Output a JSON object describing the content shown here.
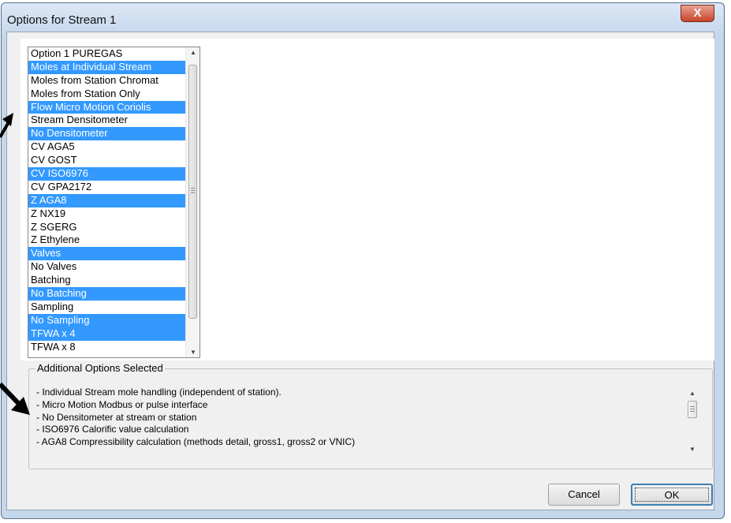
{
  "window": {
    "title": "Options for Stream 1"
  },
  "options_list": {
    "items": [
      {
        "label": "Option 1 PUREGAS",
        "selected": false
      },
      {
        "label": "Moles at Individual Stream",
        "selected": true
      },
      {
        "label": "Moles from Station Chromat",
        "selected": false
      },
      {
        "label": "Moles from Station Only",
        "selected": false
      },
      {
        "label": "Flow Micro Motion Coriolis",
        "selected": true
      },
      {
        "label": "Stream Densitometer",
        "selected": false
      },
      {
        "label": "No Densitometer",
        "selected": true
      },
      {
        "label": "CV AGA5",
        "selected": false
      },
      {
        "label": "CV GOST",
        "selected": false
      },
      {
        "label": "CV ISO6976",
        "selected": true
      },
      {
        "label": "CV GPA2172",
        "selected": false
      },
      {
        "label": "Z AGA8",
        "selected": true
      },
      {
        "label": "Z NX19",
        "selected": false
      },
      {
        "label": "Z SGERG",
        "selected": false
      },
      {
        "label": "Z Ethylene",
        "selected": false
      },
      {
        "label": "Valves",
        "selected": true
      },
      {
        "label": "No Valves",
        "selected": false
      },
      {
        "label": "Batching",
        "selected": false
      },
      {
        "label": "No Batching",
        "selected": true
      },
      {
        "label": "Sampling",
        "selected": false
      },
      {
        "label": "No Sampling",
        "selected": true
      },
      {
        "label": "TFWA x 4",
        "selected": true
      },
      {
        "label": "TFWA x 8",
        "selected": false
      }
    ]
  },
  "additional": {
    "label": "Additional Options Selected",
    "lines": [
      "- Individual Stream mole handling (independent of station).",
      "- Micro Motion Modbus or pulse interface",
      "- No Densitometer at stream or station",
      "- ISO6976 Calorific value calculation",
      "- AGA8 Compressibility calculation (methods detail, gross1, gross2 or VNIC)"
    ]
  },
  "buttons": {
    "cancel": "Cancel",
    "ok": "OK",
    "close": "X"
  },
  "colors": {
    "selection": "#3399ff",
    "frame": "#c5d7ea",
    "close_button": "#c7452c",
    "annotation_arrow": "#000000"
  }
}
